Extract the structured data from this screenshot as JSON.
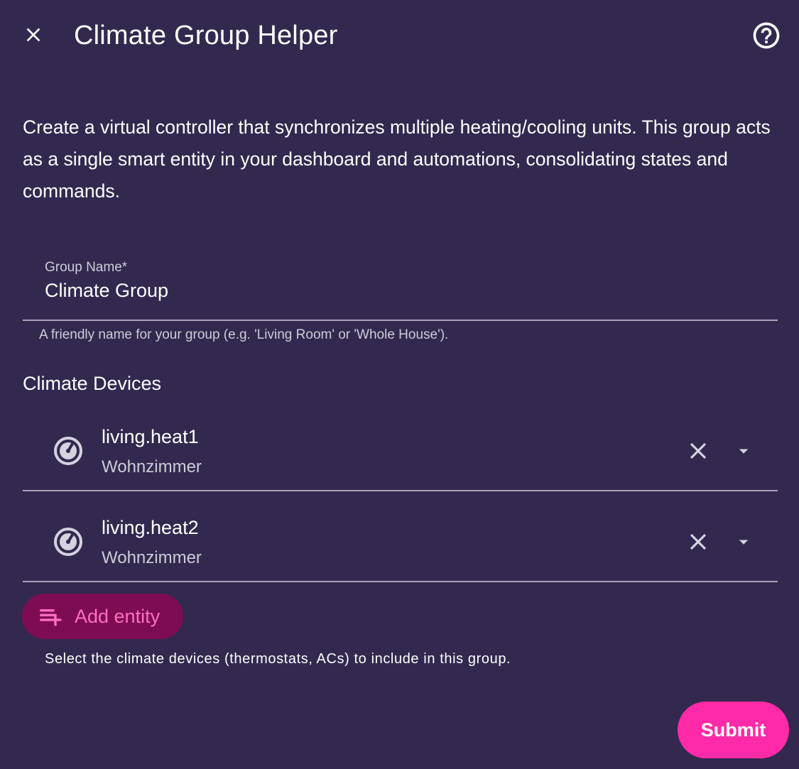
{
  "dialog": {
    "title": "Climate Group Helper",
    "close_icon": "close-icon",
    "help_icon": "help-circle-icon",
    "description": "Create a virtual controller that synchronizes multiple heating/cooling units. This group acts as a single smart entity in your dashboard and automations, consolidating states and commands."
  },
  "group_name_field": {
    "label": "Group Name*",
    "value": "Climate Group",
    "helper": "A friendly name for your group (e.g. 'Living Room' or 'Whole House')."
  },
  "climate_devices": {
    "section_title": "Climate Devices",
    "entities": [
      {
        "name": "living.heat1",
        "area": "Wohnzimmer",
        "icon": "thermostat-dial-icon"
      },
      {
        "name": "living.heat2",
        "area": "Wohnzimmer",
        "icon": "thermostat-dial-icon"
      }
    ],
    "add_button_label": "Add entity",
    "add_button_icon": "playlist-plus-icon",
    "helper": "Select the climate devices (thermostats, ACs) to include in this group."
  },
  "actions": {
    "submit_label": "Submit"
  },
  "colors": {
    "background": "#33294f",
    "accent": "#ff2aa8",
    "add_button_bg": "#7e0c52",
    "add_button_text": "#ff6fc4",
    "divider": "#a8a2b8",
    "secondary_text": "#cfcbd9"
  }
}
